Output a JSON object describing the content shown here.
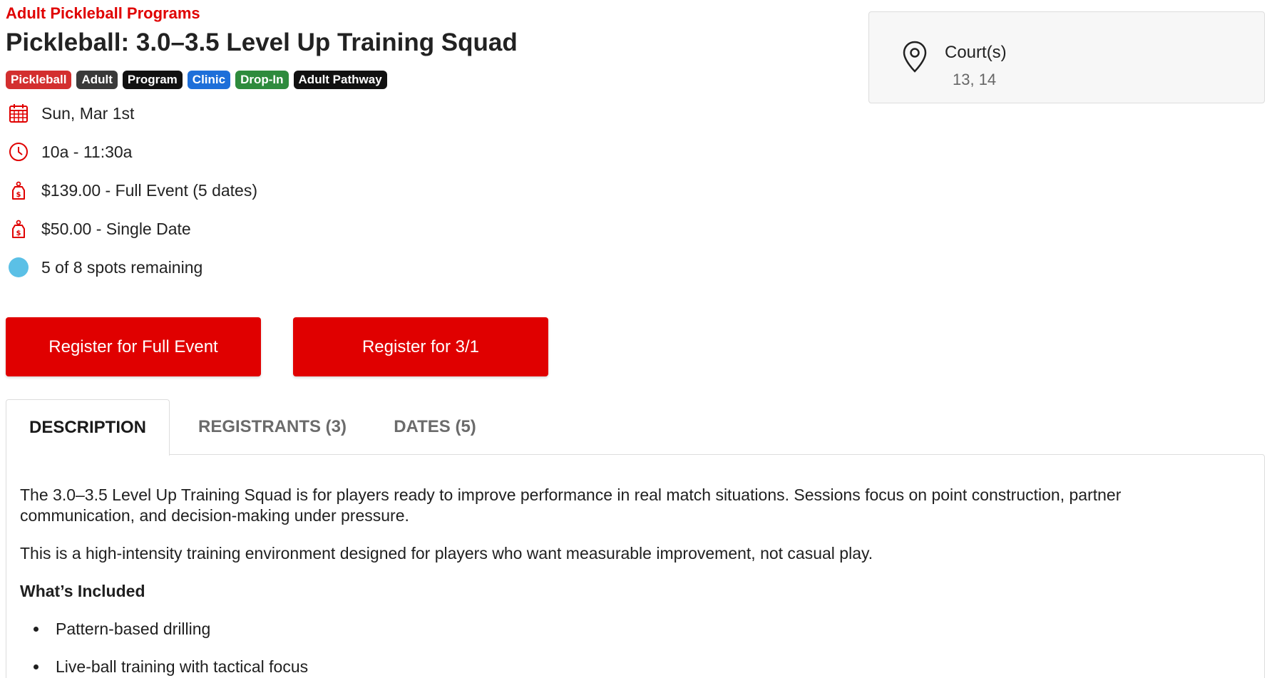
{
  "header": {
    "category": "Adult Pickleball Programs",
    "title": "Pickleball: 3.0–3.5 Level Up Training Squad"
  },
  "tags": [
    {
      "label": "Pickleball",
      "color": "#d32f2f"
    },
    {
      "label": "Adult",
      "color": "#3a3a3a"
    },
    {
      "label": "Program",
      "color": "#111111"
    },
    {
      "label": "Clinic",
      "color": "#1e6fd9"
    },
    {
      "label": "Drop-In",
      "color": "#2e8b3d"
    },
    {
      "label": "Adult Pathway",
      "color": "#111111"
    }
  ],
  "details": {
    "date": "Sun, Mar 1st",
    "time": "10a - 11:30a",
    "price_full": "$139.00 - Full Event (5 dates)",
    "price_single": "$50.00 - Single Date",
    "spots": "5 of 8 spots remaining"
  },
  "buttons": {
    "register_full": "Register for Full Event",
    "register_date": "Register for 3/1"
  },
  "location": {
    "label": "Court(s)",
    "value": "13, 14"
  },
  "tabs": [
    {
      "label": "DESCRIPTION",
      "active": true
    },
    {
      "label": "REGISTRANTS (3)",
      "active": false
    },
    {
      "label": "DATES (5)",
      "active": false
    }
  ],
  "description": {
    "para1": "The 3.0–3.5 Level Up Training Squad is for players ready to improve performance in real match situations. Sessions focus on point construction, partner communication, and decision-making under pressure.",
    "para2": "This is a high-intensity training environment designed for players who want measurable improvement, not casual play.",
    "included_heading": "What’s Included",
    "included_items": [
      "Pattern-based drilling",
      "Live-ball training with tactical focus"
    ]
  },
  "colors": {
    "accent": "#e00000",
    "spots_indicator": "#5bc0e6"
  },
  "icons": {
    "date": "calendar-icon",
    "time": "clock-icon",
    "price": "price-tag-icon",
    "spots": "spots-indicator",
    "location": "map-pin-icon"
  }
}
